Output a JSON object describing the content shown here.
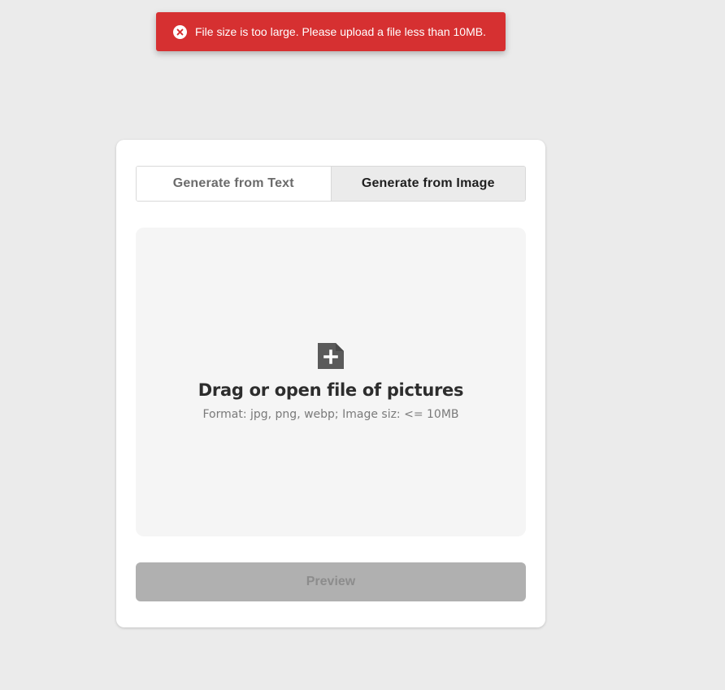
{
  "toast": {
    "message": "File size is too large. Please upload a file less than 10MB.",
    "icon": "error-circle-icon",
    "color": "#d63031"
  },
  "tabs": [
    {
      "label": "Generate from Text",
      "active": false
    },
    {
      "label": "Generate from Image",
      "active": true
    }
  ],
  "dropzone": {
    "icon": "file-add-icon",
    "title": "Drag or open file of pictures",
    "subtitle": "Format: jpg, png, webp; Image siz: <= 10MB"
  },
  "preview_button": {
    "label": "Preview",
    "disabled": true
  }
}
